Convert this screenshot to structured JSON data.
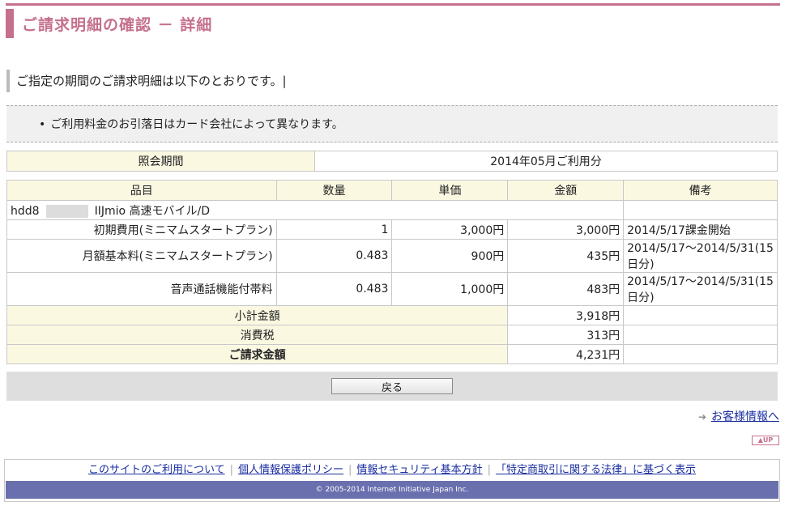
{
  "page": {
    "title": "ご請求明細の確認 － 詳細",
    "intro": "ご指定の期間のご請求明細は以下のとおりです。|",
    "note": "ご利用料金のお引落日はカード会社によって異なります。"
  },
  "period": {
    "label": "照会期間",
    "value": "2014年05月ご利用分"
  },
  "table": {
    "headers": [
      "品目",
      "数量",
      "単価",
      "金額",
      "備考"
    ],
    "group": {
      "prefix": "hdd8",
      "service": "IIJmio 高速モバイル/D"
    },
    "rows": [
      {
        "item": "初期費用(ミニマムスタートプラン)",
        "qty": "1",
        "unit": "3,000円",
        "amount": "3,000円",
        "note": "2014/5/17課金開始"
      },
      {
        "item": "月額基本料(ミニマムスタートプラン)",
        "qty": "0.483",
        "unit": "900円",
        "amount": "435円",
        "note": "2014/5/17～2014/5/31(15日分)"
      },
      {
        "item": "音声通話機能付帯料",
        "qty": "0.483",
        "unit": "1,000円",
        "amount": "483円",
        "note": "2014/5/17～2014/5/31(15日分)"
      }
    ],
    "subtotal_label": "小計金額",
    "subtotal": "3,918円",
    "tax_label": "消費税",
    "tax": "313円",
    "total_label": "ご請求金額",
    "total": "4,231円"
  },
  "actions": {
    "back_label": "戻る",
    "customer_link": "お客様情報へ",
    "up_label": "▲UP"
  },
  "footer": {
    "links": [
      "このサイトのご利用について",
      "個人情報保護ポリシー",
      "情報セキュリティ基本方針",
      "「特定商取引に関する法律」に基づく表示"
    ],
    "copyright": "© 2005-2014 Internet Initiative Japan Inc."
  }
}
